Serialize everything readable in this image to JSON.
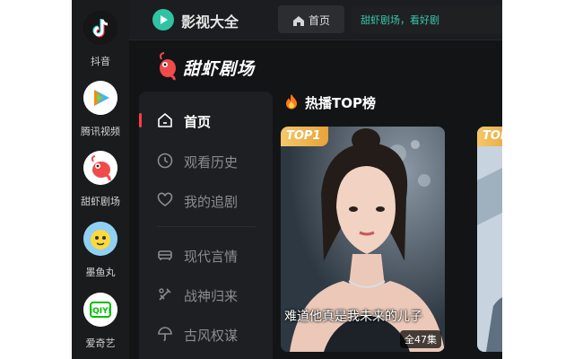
{
  "dock": {
    "items": [
      {
        "label": "抖音",
        "icon": "douyin-icon"
      },
      {
        "label": "腾讯视频",
        "icon": "tencent-video-icon"
      },
      {
        "label": "甜虾剧场",
        "icon": "shrimp-theater-icon"
      },
      {
        "label": "墨鱼丸",
        "icon": "squid-ball-icon"
      },
      {
        "label": "爱奇艺",
        "icon": "iqiyi-icon"
      }
    ]
  },
  "header": {
    "app_name": "影视大全",
    "home_tab": "首页",
    "search_placeholder": "甜虾剧场，看好剧"
  },
  "brand": {
    "name": "甜虾剧场"
  },
  "nav": {
    "items": [
      {
        "label": "首页",
        "icon": "home-icon",
        "active": true
      },
      {
        "label": "观看历史",
        "icon": "clock-icon"
      },
      {
        "label": "我的追剧",
        "icon": "heart-icon"
      },
      {
        "label": "现代言情",
        "icon": "couch-icon"
      },
      {
        "label": "战神归来",
        "icon": "sword-icon"
      },
      {
        "label": "古风权谋",
        "icon": "umbrella-icon"
      }
    ]
  },
  "section": {
    "title": "热播TOP榜",
    "icon": "fire-icon"
  },
  "cards": [
    {
      "badge": "TOP1",
      "title": "难道他真是我未来的儿子",
      "episodes": "全47集"
    },
    {
      "badge": "TOP"
    }
  ],
  "colors": {
    "accent_green": "#37c9ad",
    "active_indicator": "#ff3b4a",
    "badge_gold": "#e6a339",
    "background": "#131416"
  }
}
